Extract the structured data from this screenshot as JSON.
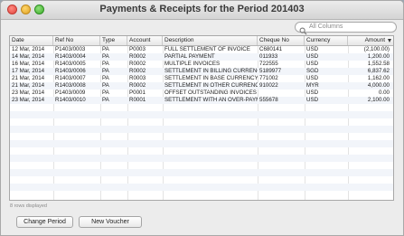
{
  "window": {
    "title": "Payments & Receipts for the Period 201403"
  },
  "search": {
    "placeholder": "All Columns"
  },
  "table": {
    "columns": [
      {
        "key": "date",
        "label": "Date"
      },
      {
        "key": "ref",
        "label": "Ref No"
      },
      {
        "key": "type",
        "label": "Type"
      },
      {
        "key": "account",
        "label": "Account"
      },
      {
        "key": "description",
        "label": "Description"
      },
      {
        "key": "cheque",
        "label": "Cheque No"
      },
      {
        "key": "currency",
        "label": "Currency"
      },
      {
        "key": "amount",
        "label": "Amount"
      }
    ],
    "rows": [
      {
        "date": "12 Mar, 2014",
        "ref": "P1403/0003",
        "type": "PA",
        "account": "P0003",
        "description": "FULL SETTLEMENT OF INVOICE",
        "cheque": "C680141",
        "currency": "USD",
        "amount": "(2,100.00)"
      },
      {
        "date": "14 Mar, 2014",
        "ref": "R1403/0004",
        "type": "PA",
        "account": "R0002",
        "description": "PARTIAL PAYMENT",
        "cheque": "011933",
        "currency": "USD",
        "amount": "1,200.00"
      },
      {
        "date": "16 Mar, 2014",
        "ref": "R1403/0005",
        "type": "PA",
        "account": "R0002",
        "description": "MULTIPLE INVOICES",
        "cheque": "722555",
        "currency": "USD",
        "amount": "1,552.58"
      },
      {
        "date": "17 Mar, 2014",
        "ref": "R1403/0006",
        "type": "PA",
        "account": "R0002",
        "description": "SETTLEMENT IN BILLING CURRENCY",
        "cheque": "5189977",
        "currency": "SGD",
        "amount": "6,837.62"
      },
      {
        "date": "21 Mar, 2014",
        "ref": "R1403/0007",
        "type": "PA",
        "account": "R0003",
        "description": "SETTLEMENT IN BASE CURRENCY",
        "cheque": "771002",
        "currency": "USD",
        "amount": "1,162.00"
      },
      {
        "date": "21 Mar, 2014",
        "ref": "R1403/0008",
        "type": "PA",
        "account": "R0002",
        "description": "SETTLEMENT IN OTHER CURRENCY",
        "cheque": "910022",
        "currency": "MYR",
        "amount": "4,000.00"
      },
      {
        "date": "23 Mar, 2014",
        "ref": "P1403/0009",
        "type": "PA",
        "account": "P0001",
        "description": "OFFSET OUTSTANDING INVOICES",
        "cheque": "",
        "currency": "USD",
        "amount": "0.00"
      },
      {
        "date": "23 Mar, 2014",
        "ref": "R1403/0010",
        "type": "PA",
        "account": "R0001",
        "description": "SETTLEMENT WITH AN OVER-PAYMEN",
        "cheque": "555678",
        "currency": "USD",
        "amount": "2,100.00"
      }
    ],
    "sorted_column": "amount",
    "sort_direction": "descending"
  },
  "status": {
    "text": "8 rows displayed"
  },
  "buttons": {
    "change_period": "Change Period",
    "new_voucher": "New Voucher"
  }
}
